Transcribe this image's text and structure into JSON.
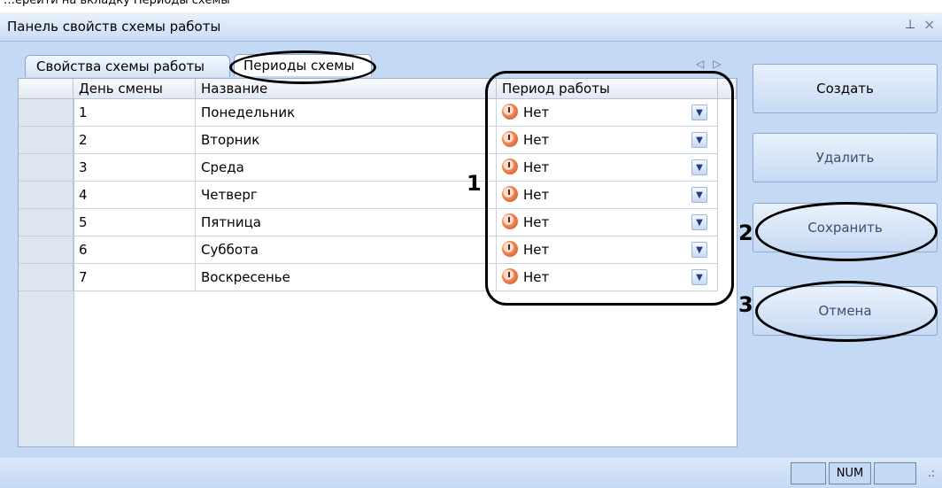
{
  "top_strip_text": "…ерейти на вкладку Периоды схемы",
  "window": {
    "title": "Панель свойств схемы работы",
    "pin_icon": "⊥",
    "close_icon": "×"
  },
  "tabs": [
    {
      "label": "Свойства схемы работы"
    },
    {
      "label": "Периоды схемы"
    }
  ],
  "table": {
    "columns": [
      "День смены",
      "Название",
      "Период работы"
    ],
    "rows": [
      {
        "day": "1",
        "name": "Понедельник",
        "period": "Нет"
      },
      {
        "day": "2",
        "name": "Вторник",
        "period": "Нет"
      },
      {
        "day": "3",
        "name": "Среда",
        "period": "Нет"
      },
      {
        "day": "4",
        "name": "Четверг",
        "period": "Нет"
      },
      {
        "day": "5",
        "name": "Пятница",
        "period": "Нет"
      },
      {
        "day": "6",
        "name": "Суббота",
        "period": "Нет"
      },
      {
        "day": "7",
        "name": "Воскресенье",
        "period": "Нет"
      }
    ]
  },
  "buttons": {
    "create": "Создать",
    "delete": "Удалить",
    "save": "Сохранить",
    "cancel": "Отмена"
  },
  "annotations": {
    "one": "1",
    "two": "2",
    "three": "3"
  },
  "statusbar": {
    "num": "NUM"
  }
}
